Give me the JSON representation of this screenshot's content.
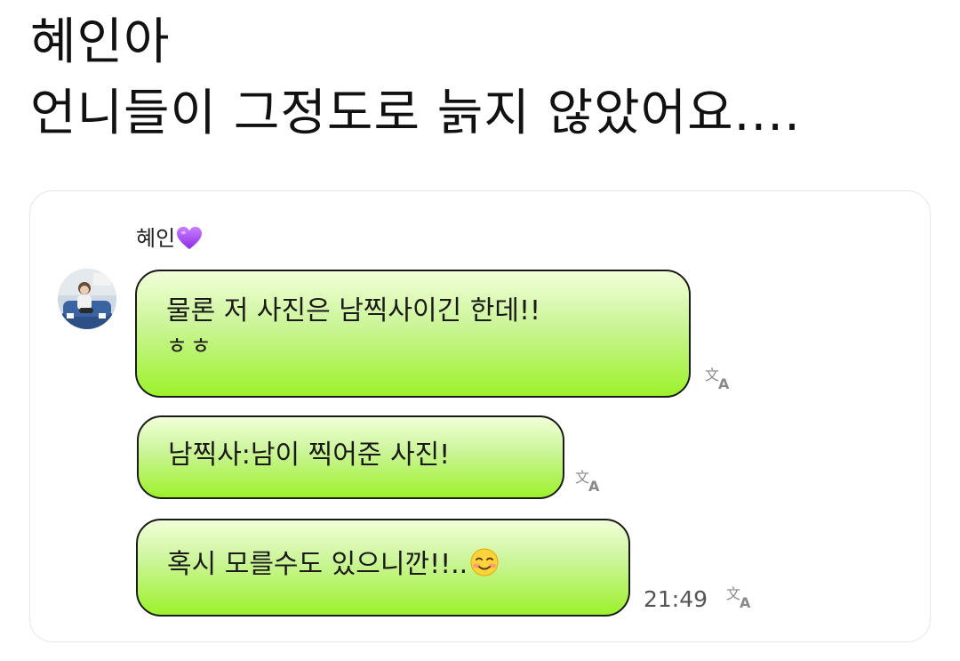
{
  "post": {
    "line1": "혜인아",
    "line2": "언니들이 그정도로 늙지 않았어요...."
  },
  "chat": {
    "sender_name": "혜인",
    "sender_emoji": "purple-heart-icon",
    "messages": [
      {
        "line1": "물론 저 사진은 남찍사이긴 한데!!",
        "line2": "ㅎㅎ"
      },
      {
        "text": "남찍사:남이 찍어준 사진!"
      },
      {
        "text": "혹시 모를수도 있으니깐!!..",
        "emoji": "smiling-face-icon"
      }
    ],
    "timestamp": "21:49",
    "translate_icon": "translate-icon"
  },
  "colors": {
    "bubble_top": "#f2ffd8",
    "bubble_bottom": "#9df12b",
    "bubble_border": "#1a1a1a",
    "heart": "#a855f7"
  }
}
